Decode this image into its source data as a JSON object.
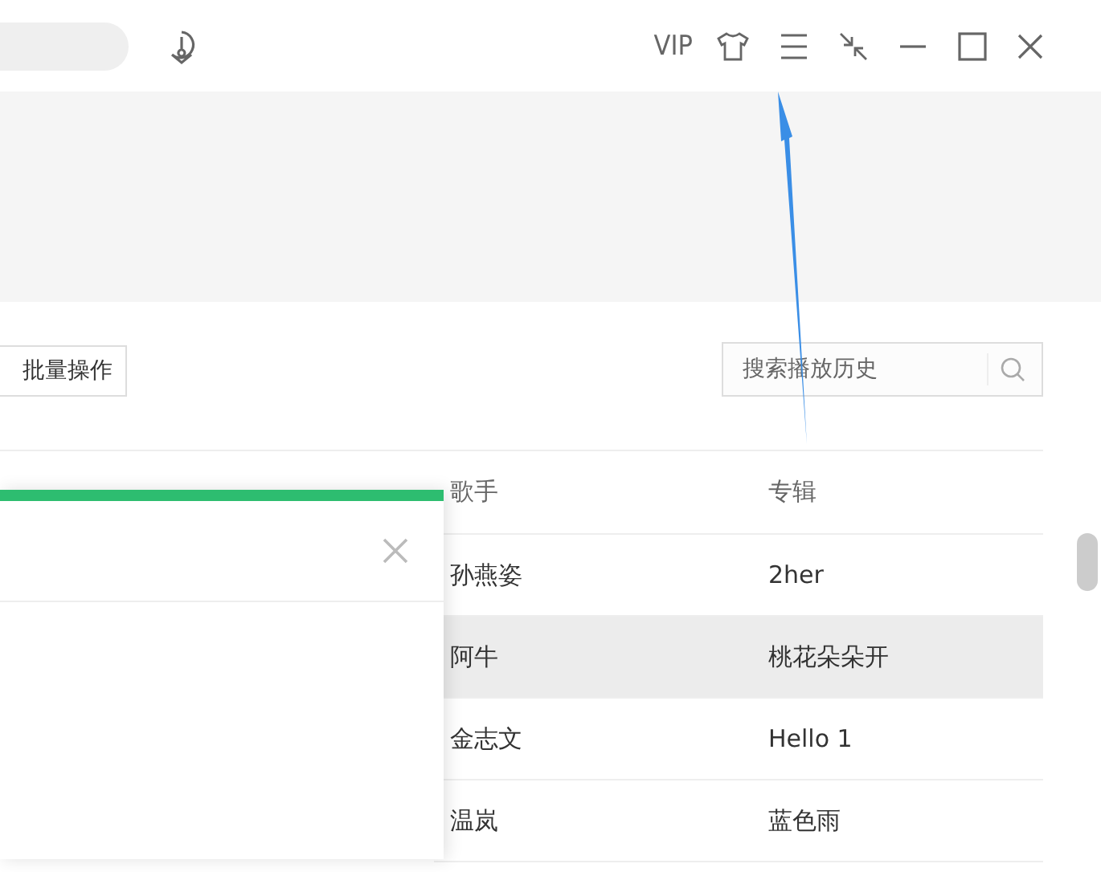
{
  "titlebar": {
    "vip": "VIP"
  },
  "toolbar": {
    "batch_button": "批量操作",
    "search": {
      "placeholder": "搜索播放历史"
    }
  },
  "table": {
    "columns": [
      "歌手",
      "专辑"
    ],
    "rows": [
      {
        "artist": "孙燕姿",
        "album": "2her",
        "selected": false
      },
      {
        "artist": "阿牛",
        "album": "桃花朵朵开",
        "selected": true
      },
      {
        "artist": "金志文",
        "album": "Hello 1",
        "selected": false
      },
      {
        "artist": "温岚",
        "album": "蓝色雨",
        "selected": false
      }
    ]
  }
}
